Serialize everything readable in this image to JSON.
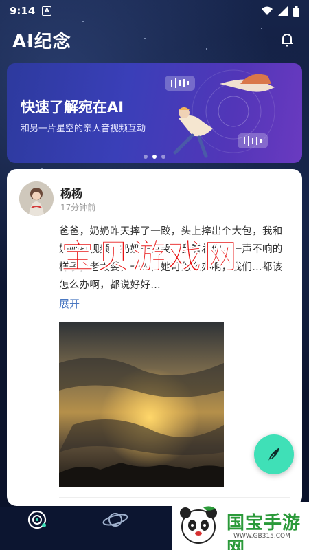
{
  "status_bar": {
    "time": "9:14",
    "notification_glyph": "A"
  },
  "header": {
    "title": "AI纪念"
  },
  "banner": {
    "title": "快速了解宛在AI",
    "subtitle": "和另一片星空的亲人音视频互动"
  },
  "post": {
    "author": "杨杨",
    "time": "17分钟前",
    "text": "爸爸，奶奶昨天摔了一跤，头上摔出个大包，我和奶奶打视频，奶奶一直哭，我看着你，一声不响的样子，老太婆，一人，她可怎么办啊，我们...都该怎么办啊，都说好好…",
    "expand_label": "展开"
  },
  "watermark": {
    "text": "宝贝游戏网"
  },
  "logo": {
    "text": "国宝手游网",
    "url": "WWW.GB315.COM"
  },
  "colors": {
    "accent": "#3fe0b7",
    "link": "#4a78c2",
    "watermark": "#e81313"
  }
}
